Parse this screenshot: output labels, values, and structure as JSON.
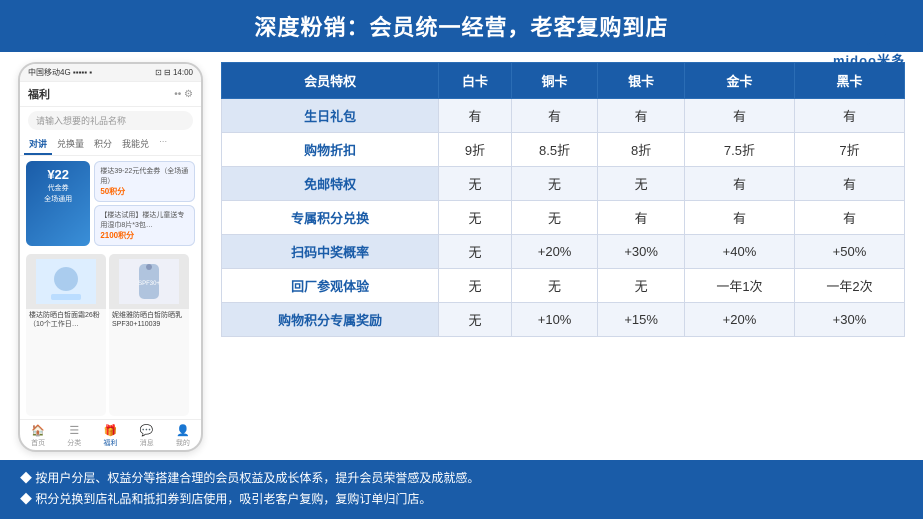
{
  "header": {
    "title": "深度粉销：会员统一经营，老客复购到店"
  },
  "logo": {
    "text": "midoo米多",
    "alt": "midoo logo"
  },
  "phone": {
    "status": {
      "carrier": "中国移动4G",
      "time": "14:00",
      "battery": "█"
    },
    "title": "福利",
    "search_placeholder": "请输入想要的礼品名称",
    "tabs": [
      "对讲",
      "兑换量",
      "积分",
      "我能兑"
    ],
    "active_tab": "对讲",
    "coupon": {
      "amount": "¥22",
      "label": "代金券",
      "sub": "全场通用"
    },
    "coupon_cards": [
      {
        "label": "楼达39-22元代金券（全场通用）",
        "points": "50积分"
      },
      {
        "label": "【楼达试用】楼达儿童送专用湿巾8片*3包…",
        "points": "2100积分"
      }
    ],
    "products": [
      {
        "name": "楼达防晒白皙面霜26粉（10个工作日…",
        "points": ""
      },
      {
        "name": "妮维雅防晒白皙防晒乳SPF30+110039",
        "points": ""
      }
    ],
    "nav_items": [
      "首页",
      "分类",
      "福利",
      "消息",
      "我的"
    ]
  },
  "table": {
    "headers": [
      "会员特权",
      "白卡",
      "铜卡",
      "银卡",
      "金卡",
      "黑卡"
    ],
    "rows": [
      [
        "生日礼包",
        "有",
        "有",
        "有",
        "有",
        "有"
      ],
      [
        "购物折扣",
        "9折",
        "8.5折",
        "8折",
        "7.5折",
        "7折"
      ],
      [
        "免邮特权",
        "无",
        "无",
        "无",
        "有",
        "有"
      ],
      [
        "专属积分兑换",
        "无",
        "无",
        "有",
        "有",
        "有"
      ],
      [
        "扫码中奖概率",
        "无",
        "+20%",
        "+30%",
        "+40%",
        "+50%"
      ],
      [
        "回厂参观体验",
        "无",
        "无",
        "无",
        "一年1次",
        "一年2次"
      ],
      [
        "购物积分专属奖励",
        "无",
        "+10%",
        "+15%",
        "+20%",
        "+30%"
      ]
    ]
  },
  "footer": {
    "lines": [
      "◆ 按用户分层、权益分等搭建合理的会员权益及成长体系，提升会员荣誉感及成就感。",
      "◆ 积分兑换到店礼品和抵扣券到店使用，吸引老客户复购，复购订单归门店。"
    ]
  }
}
